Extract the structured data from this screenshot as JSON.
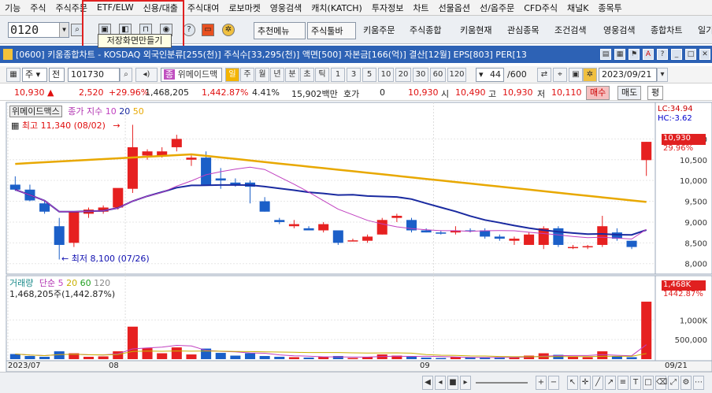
{
  "menu": [
    "기능",
    "주식",
    "주식주문",
    "ETF/ELW",
    "신용/대출",
    "주식대여",
    "로보마켓",
    "영웅검색",
    "캐치(KATCH)",
    "투자정보",
    "차트",
    "선물옵션",
    "선/옵주문",
    "CFD주식",
    "채널K",
    "종목투"
  ],
  "toolbar": {
    "screen_code": "0120",
    "tooltip": "저장화면만들기",
    "buttons": [
      "추천메뉴",
      "주식툴바",
      "키움주문",
      "주식종합",
      "키움현재",
      "관심종목",
      "조건검색",
      "영웅검색",
      "종합차트",
      "일기"
    ]
  },
  "window": {
    "title": "[0600] 키움종합차트 - KOSDAQ 외국인분류[255(천)] 주식수[33,295(천)] 액면[500] 자본금[166(억)] 결산[12월] EPS[803] PER[13"
  },
  "controls": {
    "market": "주",
    "type": "전",
    "code": "101730",
    "name": "위메이드맥",
    "period_tabs": [
      "일",
      "주",
      "월",
      "년",
      "분",
      "초",
      "틱"
    ],
    "intervals": [
      "1",
      "3",
      "5",
      "10",
      "20",
      "30",
      "60",
      "120"
    ],
    "count": "44",
    "count_total": "/600",
    "date": "2023/09/21"
  },
  "quote": {
    "price": "10,930",
    "change": "2,520",
    "change_pct": "+29.96%",
    "volume": "1,468,205",
    "volume_pct": "1,442.87%",
    "turnover_pct": "4.41%",
    "amount": "15,902백만",
    "hoga_label": "호가",
    "hoga": "0",
    "hoga_price": "10,930",
    "open_label": "시",
    "open": "10,490",
    "high_label": "고",
    "high": "10,930",
    "low_label": "저",
    "low": "10,110",
    "buy": "매수",
    "sell": "매도",
    "eval": "평"
  },
  "price_panel": {
    "legend_name": "위메이드맥스",
    "legend_ma": "종가 지수",
    "ma_periods": [
      "10",
      "20",
      "50"
    ],
    "high_note": "최고 11,340 (08/02)",
    "low_note": "최저 8,100 (07/26)",
    "lc": "LC:34.94",
    "hc": "HC:-3.62",
    "last_price": "10,930",
    "last_pct": "29.96%",
    "y_ticks": [
      "11,000",
      "10,500",
      "10,000",
      "9,500",
      "9,000",
      "8,500",
      "8,000"
    ]
  },
  "volume_panel": {
    "legend": "거래량",
    "legend_ma": "단순",
    "ma_periods": [
      "5",
      "20",
      "60",
      "120"
    ],
    "value_note": "1,468,205주(1,442.87%)",
    "last_value": "1,468K",
    "last_pct": "1442.87%",
    "y_ticks": [
      "1,000K",
      "500,000"
    ]
  },
  "x_axis": {
    "labels": [
      "2023/07",
      "08",
      "09"
    ],
    "last_label": "09/21"
  },
  "chart_data": {
    "type": "candlestick",
    "series_ohlc": [
      [
        9900,
        10100,
        9750,
        9780
      ],
      [
        9780,
        9900,
        9500,
        9520
      ],
      [
        9450,
        9500,
        9200,
        9250
      ],
      [
        8900,
        9100,
        8100,
        8450
      ],
      [
        8500,
        9200,
        8400,
        9250
      ],
      [
        9200,
        9350,
        9100,
        9300
      ],
      [
        9250,
        9400,
        9200,
        9350
      ],
      [
        9350,
        9800,
        9300,
        9820
      ],
      [
        9800,
        11340,
        9700,
        10800
      ],
      [
        10600,
        10750,
        10500,
        10700
      ],
      [
        10600,
        10800,
        10550,
        10700
      ],
      [
        10800,
        11100,
        10700,
        11000
      ],
      [
        10500,
        10600,
        10350,
        10550
      ],
      [
        10550,
        10700,
        10000,
        9900
      ],
      [
        10050,
        10300,
        9800,
        10000
      ],
      [
        9950,
        10050,
        9850,
        9900
      ],
      [
        9950,
        10000,
        9450,
        9850
      ],
      [
        9500,
        9600,
        9250,
        9250
      ],
      [
        9050,
        9100,
        8950,
        9000
      ],
      [
        8900,
        9050,
        8850,
        8950
      ],
      [
        8850,
        8900,
        8800,
        8800
      ],
      [
        8800,
        9000,
        8750,
        8950
      ],
      [
        8800,
        8800,
        8450,
        8500
      ],
      [
        8550,
        8600,
        8550,
        8560
      ],
      [
        8550,
        8700,
        8500,
        8650
      ],
      [
        8700,
        9100,
        8700,
        9050
      ],
      [
        9100,
        9200,
        9000,
        9150
      ],
      [
        9050,
        9100,
        8750,
        8800
      ],
      [
        8800,
        8850,
        8750,
        8750
      ],
      [
        8750,
        8800,
        8700,
        8720
      ],
      [
        8750,
        8900,
        8700,
        8800
      ],
      [
        8800,
        8850,
        8750,
        8780
      ],
      [
        8800,
        8850,
        8600,
        8650
      ],
      [
        8650,
        8700,
        8550,
        8600
      ],
      [
        8550,
        8650,
        8450,
        8600
      ],
      [
        8450,
        8750,
        8500,
        8700
      ],
      [
        8450,
        8900,
        8350,
        8850
      ],
      [
        8850,
        8900,
        8400,
        8450
      ],
      [
        8400,
        8450,
        8350,
        8400
      ],
      [
        8400,
        8450,
        8350,
        8420
      ],
      [
        8450,
        9150,
        8400,
        8900
      ],
      [
        8750,
        8850,
        8550,
        8600
      ],
      [
        8550,
        8550,
        8350,
        8400
      ],
      [
        10490,
        10930,
        10110,
        10930
      ]
    ],
    "volume": [
      130000,
      80000,
      60000,
      200000,
      150000,
      60000,
      70000,
      200000,
      830000,
      280000,
      150000,
      300000,
      120000,
      270000,
      160000,
      90000,
      150000,
      80000,
      60000,
      50000,
      40000,
      60000,
      80000,
      30000,
      50000,
      120000,
      90000,
      60000,
      40000,
      30000,
      50000,
      40000,
      50000,
      40000,
      50000,
      90000,
      150000,
      110000,
      60000,
      50000,
      200000,
      70000,
      50000,
      1468205
    ],
    "ylim": [
      7900,
      11500
    ],
    "vol_ylim": [
      0,
      1650000
    ]
  }
}
